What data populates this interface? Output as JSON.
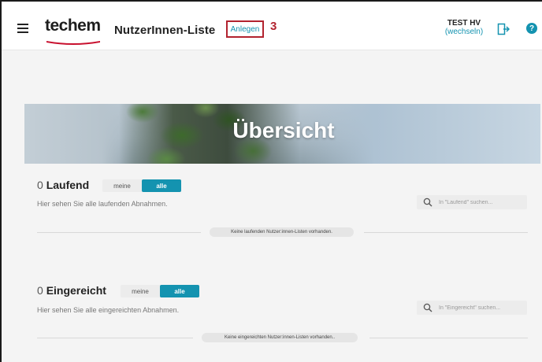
{
  "header": {
    "logo_text": "techem",
    "page_title": "NutzerInnen-Liste",
    "create_label": "Anlegen",
    "annotation_number": "3",
    "user_name": "TEST HV",
    "user_switch": "(wechseln)",
    "help_label": "?"
  },
  "banner": {
    "title": "Übersicht"
  },
  "sections": [
    {
      "count": "0",
      "title": "Laufend",
      "toggle_off": "meine",
      "toggle_on": "alle",
      "description": "Hier sehen Sie alle laufenden Abnahmen.",
      "search_placeholder": "In \"Laufend\" suchen...",
      "empty_message": "Keine laufenden Nutzer:innen-Listen vorhanden."
    },
    {
      "count": "0",
      "title": "Eingereicht",
      "toggle_off": "meine",
      "toggle_on": "alle",
      "description": "Hier sehen Sie alle eingereichten Abnahmen.",
      "search_placeholder": "In \"Eingereicht\" suchen...",
      "empty_message": "Keine eingereichten Nutzer:innen-Listen vorhanden.."
    }
  ],
  "colors": {
    "accent": "#1493b0",
    "brand_red": "#b2232f",
    "annotation_red": "#b2232f"
  },
  "icons": [
    "menu-icon",
    "logout-icon",
    "help-icon",
    "search-icon"
  ]
}
